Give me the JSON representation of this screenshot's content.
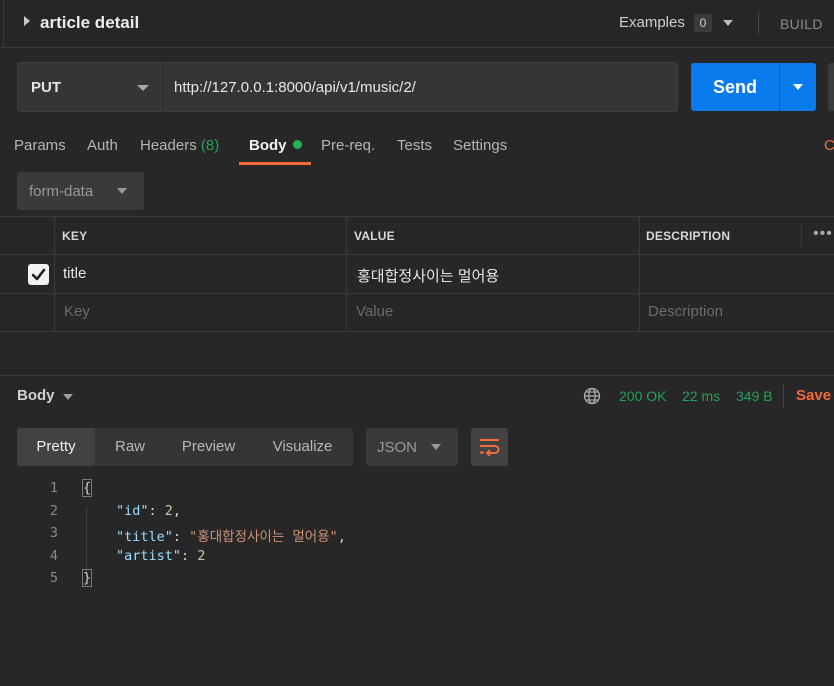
{
  "header": {
    "title": "article detail",
    "examples_label": "Examples",
    "examples_count": "0",
    "build_label": "BUILD"
  },
  "request": {
    "method": "PUT",
    "url": "http://127.0.0.1:8000/api/v1/music/2/",
    "send_label": "Send"
  },
  "tabs": {
    "params": "Params",
    "auth": "Auth",
    "headers": "Headers",
    "headers_count": "(8)",
    "body": "Body",
    "prereq": "Pre-req.",
    "tests": "Tests",
    "settings": "Settings",
    "cookies_stub": "C"
  },
  "body_type": "form-data",
  "kv_table": {
    "columns": [
      "KEY",
      "VALUE",
      "DESCRIPTION"
    ],
    "rows": [
      {
        "checked": true,
        "key": "title",
        "value": "홍대합정사이는 멀어용",
        "description": ""
      }
    ],
    "placeholder": {
      "key": "Key",
      "value": "Value",
      "description": "Description"
    },
    "more": "•••"
  },
  "response": {
    "body_label": "Body",
    "status": "200 OK",
    "time": "22 ms",
    "size": "349 B",
    "save_label": "Save",
    "view_modes": [
      "Pretty",
      "Raw",
      "Preview",
      "Visualize"
    ],
    "active_view": "Pretty",
    "language": "JSON",
    "code_lines": [
      {
        "n": "1",
        "text": "{"
      },
      {
        "n": "2",
        "text": "\"id\": 2,"
      },
      {
        "n": "3",
        "text": "\"title\": \"홍대합정사이는 멀어용\","
      },
      {
        "n": "4",
        "text": "\"artist\": 2"
      },
      {
        "n": "5",
        "text": "}"
      }
    ]
  },
  "colors": {
    "accent_orange": "#f26b3a",
    "send_blue": "#097bed",
    "status_green": "#26a05a",
    "background": "#272727"
  }
}
